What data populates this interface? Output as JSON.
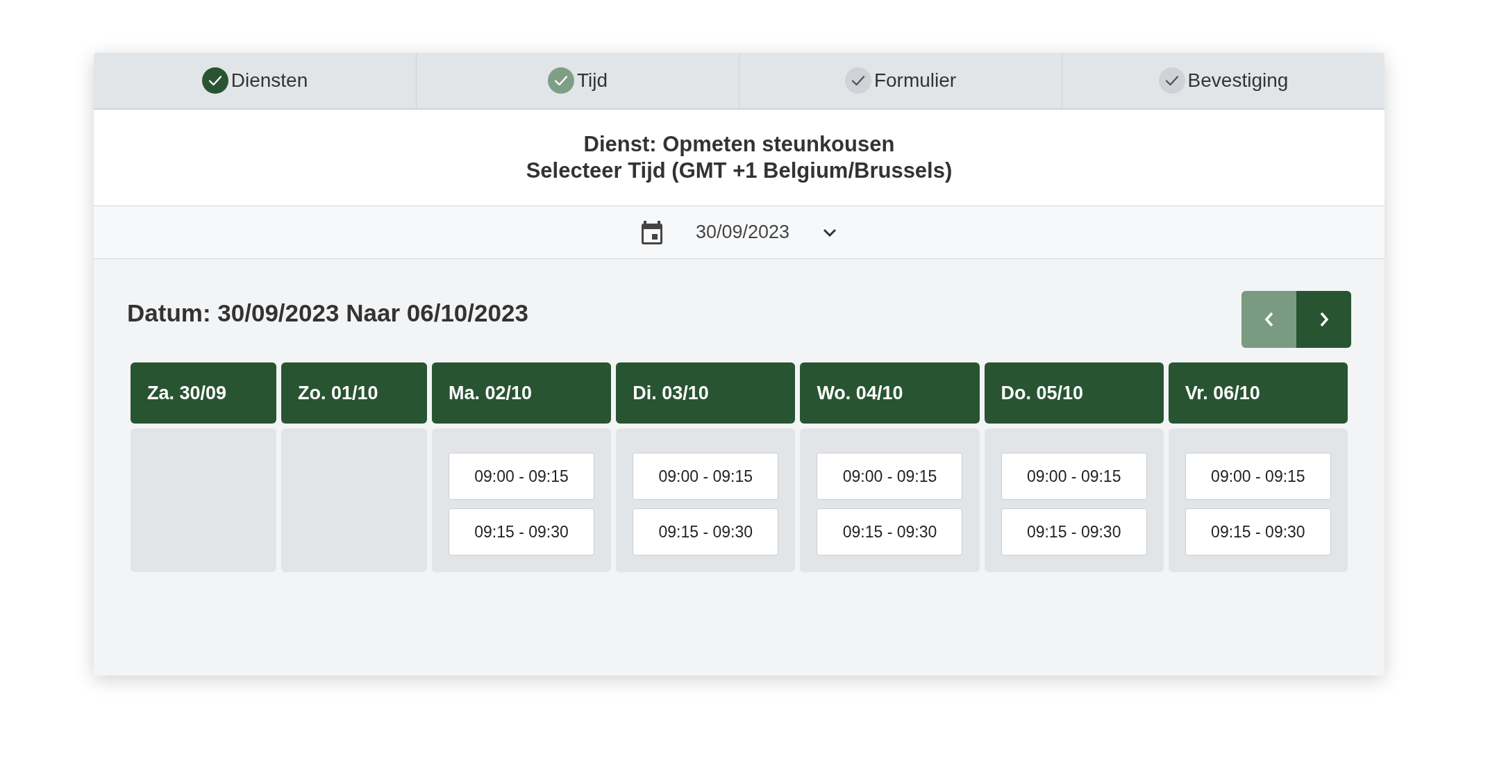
{
  "steps": [
    {
      "label": "Diensten",
      "completed": true,
      "selected": false
    },
    {
      "label": "Tijd",
      "completed": false,
      "selected": true
    },
    {
      "label": "Formulier",
      "completed": false,
      "selected": false
    },
    {
      "label": "Bevestiging",
      "completed": false,
      "selected": false
    }
  ],
  "heading": {
    "service": "Dienst: Opmeten steunkousen",
    "subtitle": "Selecteer Tijd (GMT +1 Belgium/Brussels)"
  },
  "date_picker": {
    "value": "30/09/2023"
  },
  "range_title": "Datum: 30/09/2023 Naar 06/10/2023",
  "nav": {
    "previous": {
      "disabled": true
    },
    "next": {
      "disabled": false
    }
  },
  "days": [
    {
      "label": "Za. 30/09"
    },
    {
      "label": "Zo. 01/10"
    },
    {
      "label": "Ma. 02/10",
      "slots": [
        "09:00 - 09:15",
        "09:15 - 09:30"
      ]
    },
    {
      "label": "Di. 03/10",
      "slots": [
        "09:00 - 09:15",
        "09:15 - 09:30"
      ]
    },
    {
      "label": "Wo. 04/10",
      "slots": [
        "09:00 - 09:15",
        "09:15 - 09:30"
      ]
    },
    {
      "label": "Do. 05/10",
      "slots": [
        "09:00 - 09:15",
        "09:15 - 09:30"
      ]
    },
    {
      "label": "Vr. 06/10",
      "slots": [
        "09:00 - 09:15",
        "09:15 - 09:30"
      ]
    }
  ]
}
